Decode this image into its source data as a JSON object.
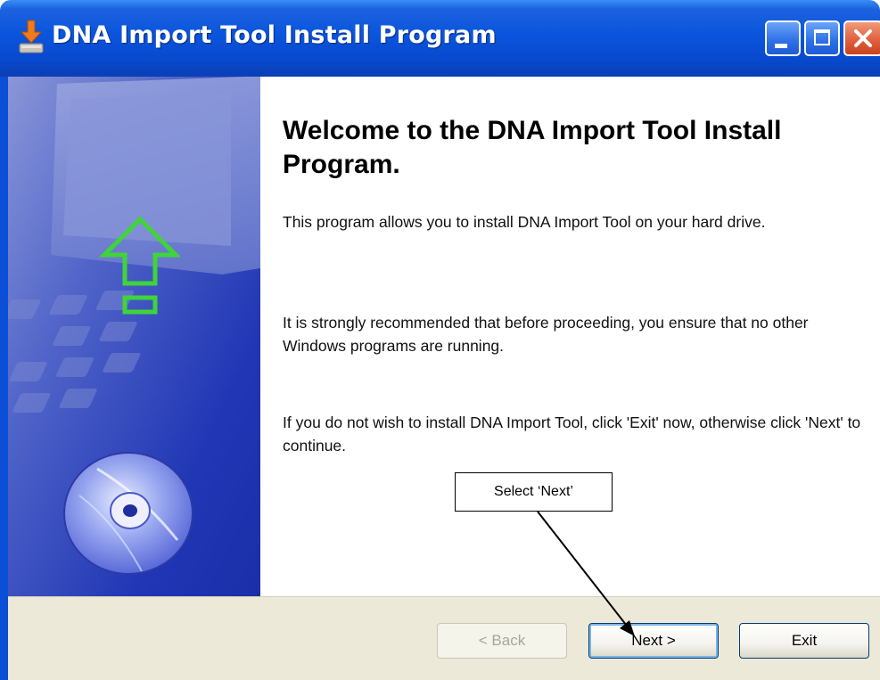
{
  "window": {
    "title": "DNA Import Tool Install Program",
    "controls": [
      "minimize",
      "maximize",
      "close"
    ]
  },
  "content": {
    "heading": "Welcome to the DNA Import Tool Install Program.",
    "paragraphs": [
      "This program allows you to install DNA Import Tool on your hard drive.",
      "It is strongly recommended that before proceeding, you ensure that no other Windows programs are running.",
      "If you do not wish to install DNA Import Tool, click 'Exit' now, otherwise click 'Next' to continue."
    ]
  },
  "buttons": {
    "back": "< Back",
    "next": "Next >",
    "exit": "Exit"
  },
  "annotation": {
    "callout": "Select ‘Next’"
  },
  "colors": {
    "titlebar": "#0a55dd",
    "footer": "#ece9d8",
    "side_panel": "#1f3fb8",
    "arrow_icon": "#3fd43a",
    "close_button": "#e0603d"
  },
  "icons": {
    "app": "installer-icon",
    "arrow": "upload-arrow-icon",
    "disc": "cd-disc-icon"
  }
}
